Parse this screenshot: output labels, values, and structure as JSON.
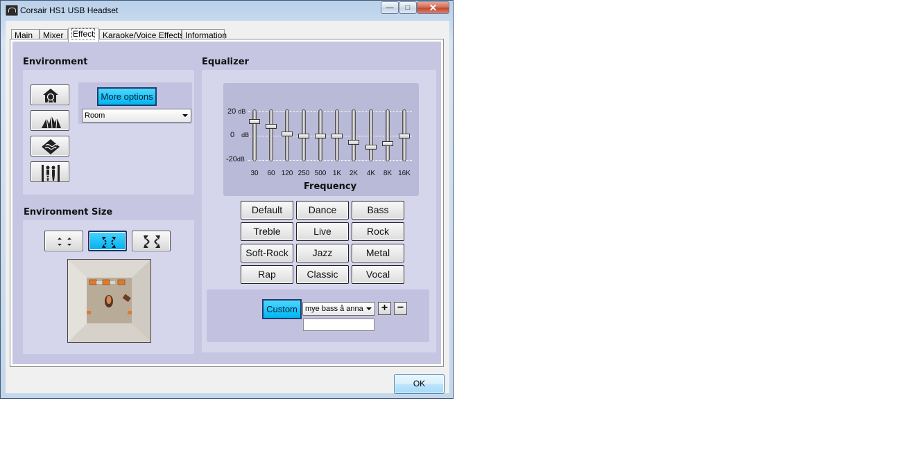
{
  "window": {
    "title": "Corsair HS1 USB Headset",
    "minimize": "—",
    "maximize": "□",
    "close": "✕"
  },
  "tabs": [
    {
      "label": "Main"
    },
    {
      "label": "Mixer"
    },
    {
      "label": "Effect"
    },
    {
      "label": "Karaoke/Voice Effects"
    },
    {
      "label": "Information"
    }
  ],
  "environment": {
    "title": "Environment",
    "more_options": "More options",
    "room_select": "Room",
    "icons": [
      "room-icon",
      "opera-house-icon",
      "underwater-icon",
      "stage-icon"
    ]
  },
  "environment_size": {
    "title": "Environment Size",
    "sizes": [
      "small",
      "medium",
      "large"
    ],
    "selected": "medium"
  },
  "equalizer": {
    "title": "Equalizer",
    "db_labels": [
      {
        "value": "20",
        "unit": "dB"
      },
      {
        "value": "0",
        "unit": "dB"
      },
      {
        "value": "-20",
        "unit": "dB"
      }
    ],
    "bands": [
      {
        "label": "30",
        "gain_db": 12
      },
      {
        "label": "60",
        "gain_db": 8
      },
      {
        "label": "120",
        "gain_db": 2
      },
      {
        "label": "250",
        "gain_db": 0
      },
      {
        "label": "500",
        "gain_db": 0
      },
      {
        "label": "1K",
        "gain_db": 0
      },
      {
        "label": "2K",
        "gain_db": -5
      },
      {
        "label": "4K",
        "gain_db": -9
      },
      {
        "label": "8K",
        "gain_db": -6
      },
      {
        "label": "16K",
        "gain_db": 0
      }
    ],
    "frequency_label": "Frequency",
    "presets": [
      "Default",
      "Dance",
      "Bass",
      "Treble",
      "Live",
      "Rock",
      "Soft-Rock",
      "Jazz",
      "Metal",
      "Rap",
      "Classic",
      "Vocal"
    ],
    "custom": {
      "button": "Custom",
      "selected": "mye bass å anna",
      "add": "+",
      "remove": "−",
      "name_value": ""
    }
  },
  "ok_button": "OK"
}
